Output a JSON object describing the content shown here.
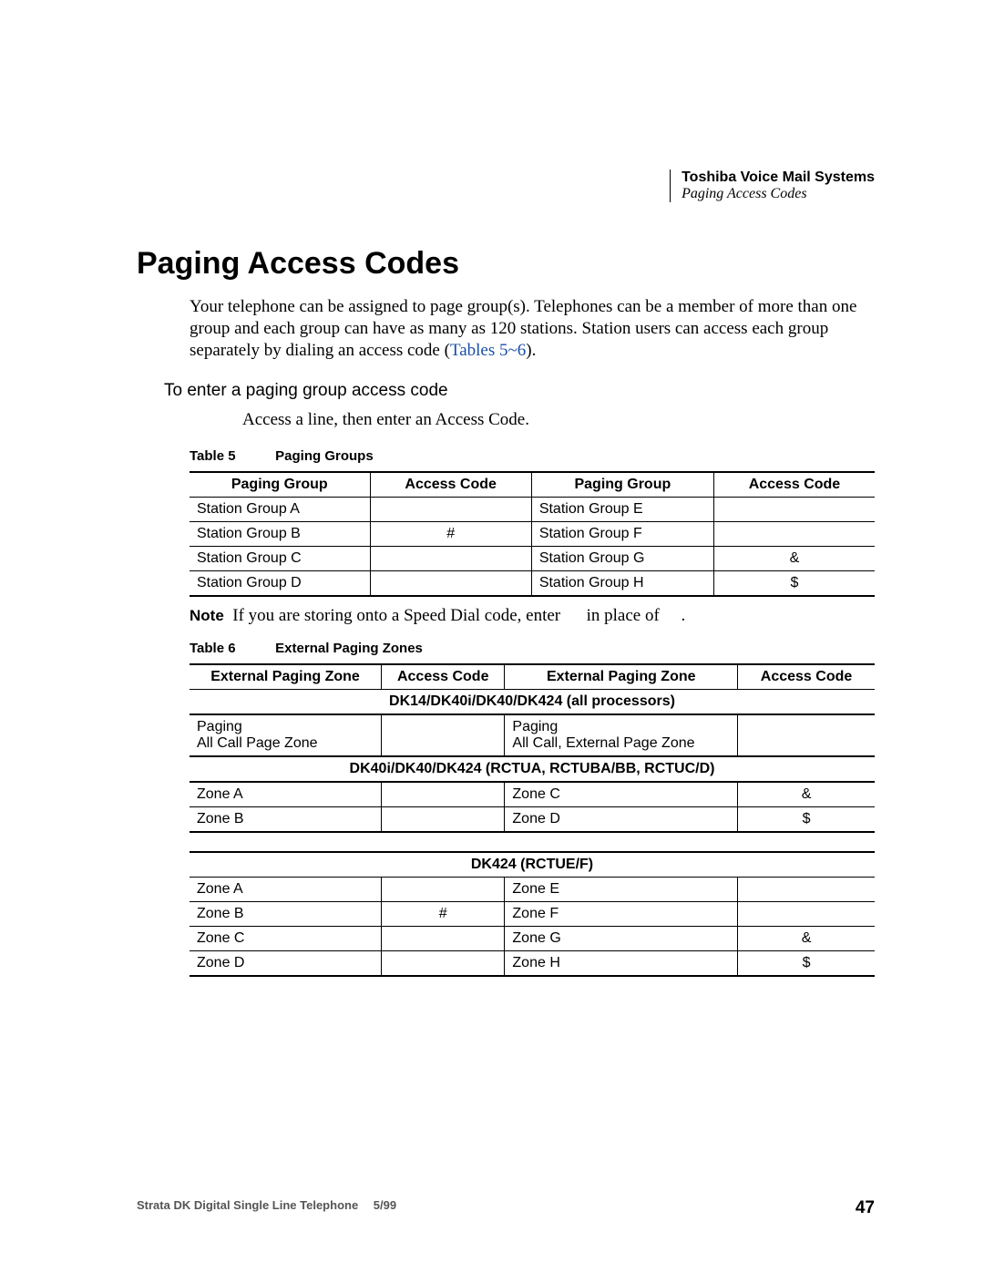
{
  "runningHead": {
    "line1": "Toshiba Voice Mail Systems",
    "line2": "Paging Access Codes"
  },
  "title": "Paging Access Codes",
  "intro": {
    "text1": "Your telephone can be assigned to page group(s). Telephones can be a member of more than one group and each group can have as many as 120 stations. Station users can access each group separately by dialing an access code (",
    "xref": "Tables 5~6",
    "text2": ")."
  },
  "subhead": "To enter a paging group access code",
  "step": "Access a line, then enter an Access Code.",
  "table5": {
    "label": "Table 5",
    "title": "Paging Groups",
    "headers": [
      "Paging Group",
      "Access Code",
      "Paging Group",
      "Access Code"
    ],
    "rows": [
      [
        "Station Group A",
        "",
        "Station Group E",
        ""
      ],
      [
        "Station Group B",
        "#",
        "Station Group F",
        ""
      ],
      [
        "Station Group C",
        "",
        "Station Group G",
        "&"
      ],
      [
        "Station Group D",
        "",
        "Station Group H",
        "$"
      ]
    ]
  },
  "note": {
    "label": "Note",
    "text": "If you are storing onto a Speed Dial code, enter   in place of  ."
  },
  "table6": {
    "label": "Table 6",
    "title": "External Paging Zones",
    "headers": [
      "External Paging Zone",
      "Access Code",
      "External Paging Zone",
      "Access Code"
    ],
    "section1": "DK14/DK40i/DK40/DK424 (all processors)",
    "rows1": [
      [
        "Paging\nAll Call Page Zone",
        "",
        "Paging\nAll Call, External Page Zone",
        ""
      ]
    ],
    "section2": "DK40i/DK40/DK424 (RCTUA, RCTUBA/BB, RCTUC/D)",
    "rows2": [
      [
        "Zone A",
        "",
        "Zone C",
        "&"
      ],
      [
        "Zone B",
        "",
        "Zone D",
        "$"
      ]
    ]
  },
  "table7": {
    "section": "DK424 (RCTUE/F)",
    "rows": [
      [
        "Zone A",
        "",
        "Zone E",
        ""
      ],
      [
        "Zone B",
        "#",
        "Zone F",
        ""
      ],
      [
        "Zone C",
        "",
        "Zone G",
        "&"
      ],
      [
        "Zone D",
        "",
        "Zone H",
        "$"
      ]
    ]
  },
  "footer": {
    "left": "Strata DK Digital Single Line Telephone  5/99",
    "page": "47"
  }
}
